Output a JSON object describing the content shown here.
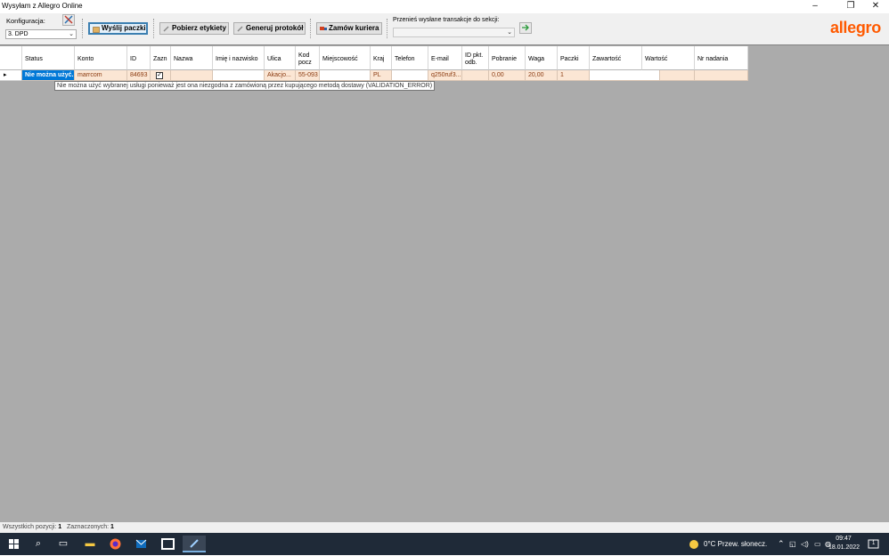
{
  "window": {
    "title": "Wysyłam z Allegro Online",
    "minimize": "–",
    "restore": "❐",
    "close": "✕"
  },
  "toolbar": {
    "config_label": "Konfiguracja:",
    "config_value": "3. DPD",
    "send_label": "Wyślij paczki",
    "labels_label": "Pobierz etykiety",
    "protocol_label": "Generuj protokół",
    "courier_label": "Zamów kuriera",
    "move_label": "Przenieś wysłane transakcje do sekcji:",
    "move_value": "",
    "logo": "allegro"
  },
  "grid": {
    "columns": [
      "Status",
      "Konto",
      "ID",
      "Zazn",
      "Nazwa",
      "Imię i nazwisko",
      "Ulica",
      "Kod pocz",
      "Miejscowość",
      "Kraj",
      "Telefon",
      "E-mail",
      "ID pkt. odb.",
      "Pobranie",
      "Waga",
      "Paczki",
      "Zawartość",
      "Wartość",
      "Nr nadania"
    ],
    "row": {
      "status": "Nie można użyć...",
      "konto": "marrcom",
      "id": "84693",
      "zazn": "✓",
      "nazwa": "",
      "imie": "",
      "ulica": "Akacjo...",
      "kod": "55-093",
      "miejscowosc": "",
      "kraj": "PL",
      "telefon": "",
      "email": "q250ruf3...",
      "idpkt": "",
      "pobranie": "0,00",
      "waga": "20,00",
      "paczki": "1",
      "zawartosc": "",
      "wartosc": "",
      "nrnadania": ""
    },
    "row_marker": "▸",
    "tooltip": "Nie można użyć wybranej usługi ponieważ jest ona niezgodna z zamówioną przez kupującego metodą dostawy (VALIDATION_ERROR)"
  },
  "statusbar": {
    "total_label": "Wszystkich pozycji:",
    "total_value": "1",
    "selected_label": "Zaznaczonych:",
    "selected_value": "1"
  },
  "taskbar": {
    "weather": "0°C  Przew. słonecz.",
    "time": "09:47",
    "date": "18.01.2022",
    "notifications": "1"
  },
  "colors": {
    "accent": "#0078d7",
    "row_error": "#fbe6d4",
    "brand": "#ff5a00"
  }
}
